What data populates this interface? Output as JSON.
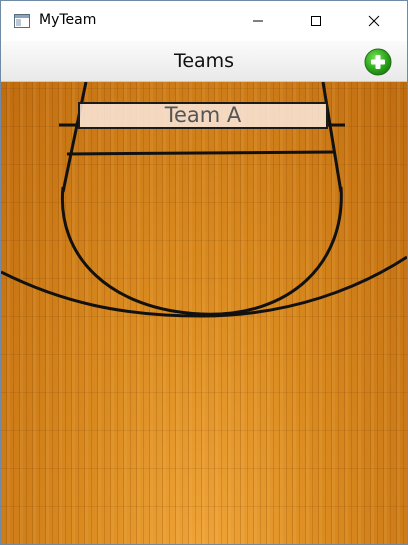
{
  "window": {
    "title": "MyTeam",
    "app_icon": "app-window-icon",
    "controls": {
      "minimize_icon": "minimize-icon",
      "maximize_icon": "maximize-icon",
      "close_icon": "close-icon"
    }
  },
  "navbar": {
    "title": "Teams",
    "add_icon": "add-circle-icon",
    "add_color": "#2eaa1c"
  },
  "teams": [
    {
      "name": "Team A"
    }
  ],
  "colors": {
    "court_wood": "#d98a1f",
    "court_line": "#111111",
    "title_bar": "#ffffff",
    "navbar": "#f2f2f2"
  }
}
